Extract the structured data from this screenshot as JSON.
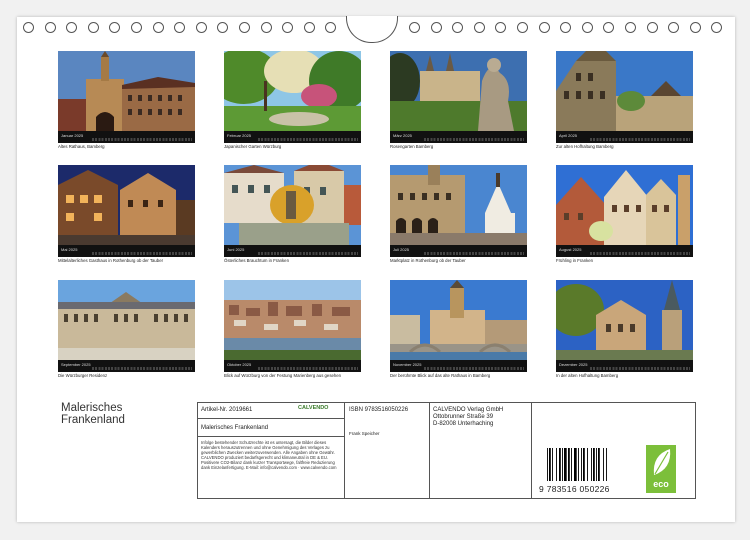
{
  "calendar": {
    "title_lines": [
      "Malerisches",
      "Frankenland"
    ],
    "months": [
      {
        "label": "Januar 2025",
        "caption": "Altes Rathaus, Bamberg"
      },
      {
        "label": "Februar 2025",
        "caption": "Japanischer Garten Würzburg"
      },
      {
        "label": "März 2025",
        "caption": "Rosengarten Bamberg"
      },
      {
        "label": "April 2025",
        "caption": "Zur alten Hofhaltung Bamberg"
      },
      {
        "label": "Mai 2025",
        "caption": "Mittelalterliches Gasthaus in Rothenburg ob der Tauber"
      },
      {
        "label": "Juni 2025",
        "caption": "Österliches Brauchtum in Franken"
      },
      {
        "label": "Juli 2025",
        "caption": "Marktplatz in Rothenburg ob der Tauber"
      },
      {
        "label": "August 2025",
        "caption": "Frühling in Franken"
      },
      {
        "label": "September 2025",
        "caption": "Die Würzburger Residenz"
      },
      {
        "label": "Oktober 2025",
        "caption": "Blick auf Würzburg von der Festung Marienberg aus gesehen"
      },
      {
        "label": "November 2025",
        "caption": "Der berühmte Blick auf das alte Rathaus in Bamberg"
      },
      {
        "label": "Dezember 2025",
        "caption": "In der alten Hofhaltung Bamberg"
      }
    ]
  },
  "info": {
    "article": "Artikel-Nr. 2019661",
    "calvendo_logo": "CALVENDO",
    "product_title": "Malerisches Frankenland",
    "disclaimer": "Infolge bestehender Schutzrechte ist es untersagt, die Bilder dieses Kalenders herauszutrennen und ohne Genehmigung des Verlages zu gewerblichen Zwecken weiterzuverwenden. Alle Angaben ohne Gewähr. CALVENDO produziert bedarfsgerecht und klimaneutral in DE & EU. Positivere CO2-Bilanz dank kurzer Transportwege, faltfreie Reduzierung dank Einzelanfertigung. E-Mail: info@calvendo.com · www.calvendo.com",
    "isbn": "ISBN 9783516050226",
    "author": "Frank Speicher",
    "publisher": [
      "CALVENDO Verlag GmbH",
      "Ottobrunner Straße 39",
      "D-82008 Unterhaching"
    ],
    "barcode_text": "9 783516 050226",
    "eco_label": "eco"
  },
  "colors": {
    "paper": "#ffffff",
    "background": "#f1f1f1",
    "eco": "#7cbf3a",
    "strip": "#111111"
  }
}
